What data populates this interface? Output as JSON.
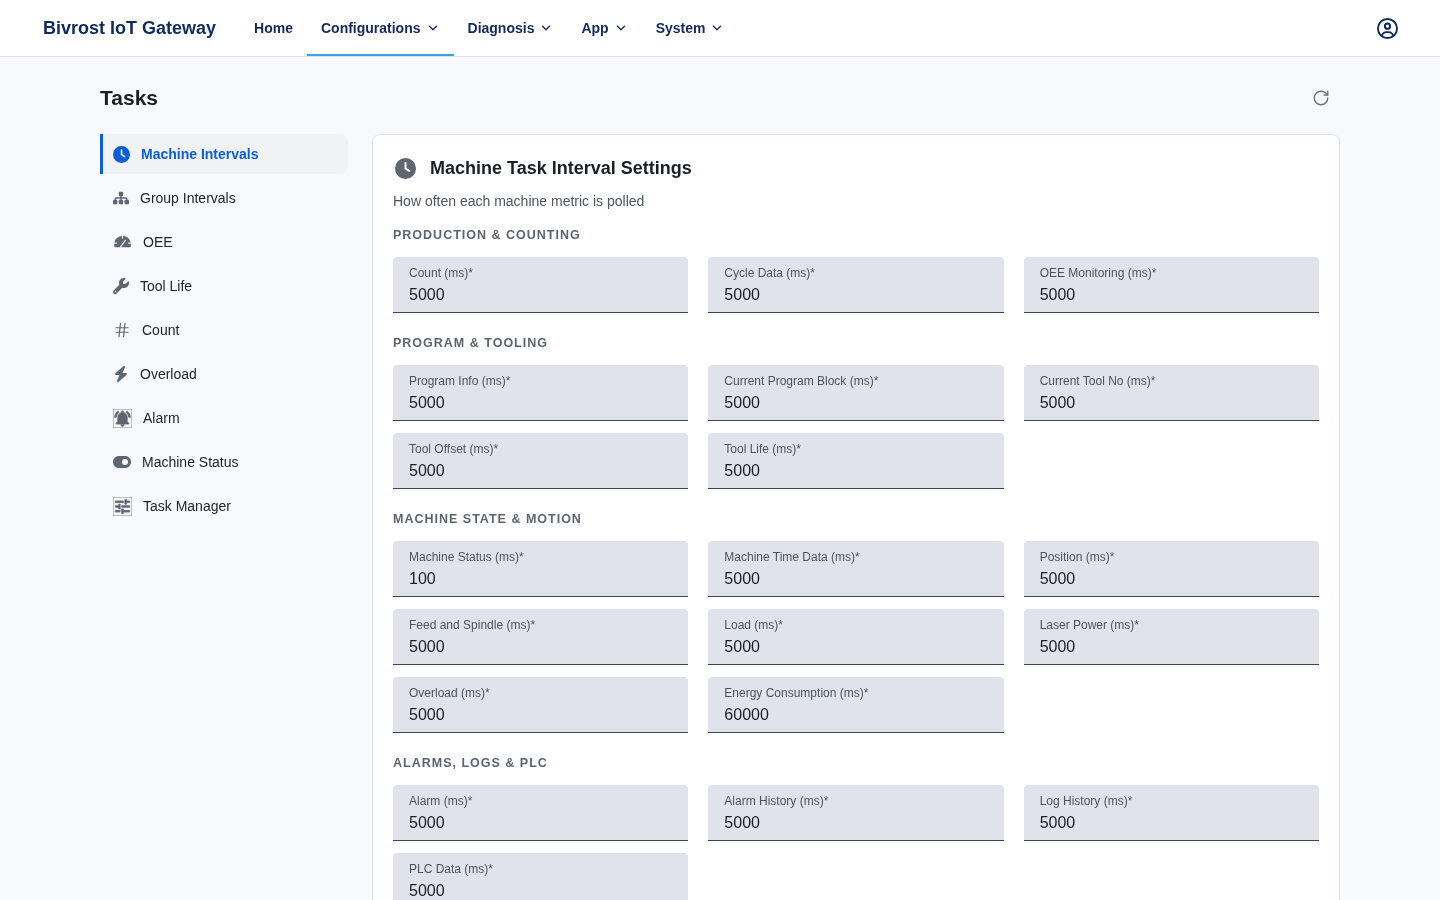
{
  "header": {
    "brand": "Bivrost IoT Gateway",
    "nav": [
      {
        "label": "Home",
        "selected": false,
        "has_menu": false
      },
      {
        "label": "Configurations",
        "selected": true,
        "has_menu": true
      },
      {
        "label": "Diagnosis",
        "selected": false,
        "has_menu": true
      },
      {
        "label": "App",
        "selected": false,
        "has_menu": true
      },
      {
        "label": "System",
        "selected": false,
        "has_menu": true
      }
    ]
  },
  "page": {
    "title": "Tasks"
  },
  "sidebar": {
    "items": [
      {
        "label": "Machine Intervals",
        "selected": true
      },
      {
        "label": "Group Intervals",
        "selected": false
      },
      {
        "label": "OEE",
        "selected": false
      },
      {
        "label": "Tool Life",
        "selected": false
      },
      {
        "label": "Count",
        "selected": false
      },
      {
        "label": "Overload",
        "selected": false
      },
      {
        "label": "Alarm",
        "selected": false
      },
      {
        "label": "Machine Status",
        "selected": false
      },
      {
        "label": "Task Manager",
        "selected": false
      }
    ]
  },
  "card": {
    "title": "Machine Task Interval Settings",
    "subtitle": "How often each machine metric is polled",
    "sections": [
      {
        "heading": "PRODUCTION & COUNTING",
        "fields": [
          {
            "label": "Count (ms)*",
            "value": "5000"
          },
          {
            "label": "Cycle Data (ms)*",
            "value": "5000"
          },
          {
            "label": "OEE Monitoring (ms)*",
            "value": "5000"
          }
        ]
      },
      {
        "heading": "PROGRAM & TOOLING",
        "fields": [
          {
            "label": "Program Info (ms)*",
            "value": "5000"
          },
          {
            "label": "Current Program Block (ms)*",
            "value": "5000"
          },
          {
            "label": "Current Tool No (ms)*",
            "value": "5000"
          },
          {
            "label": "Tool Offset (ms)*",
            "value": "5000"
          },
          {
            "label": "Tool Life (ms)*",
            "value": "5000"
          }
        ]
      },
      {
        "heading": "MACHINE STATE & MOTION",
        "fields": [
          {
            "label": "Machine Status (ms)*",
            "value": "100"
          },
          {
            "label": "Machine Time Data (ms)*",
            "value": "5000"
          },
          {
            "label": "Position (ms)*",
            "value": "5000"
          },
          {
            "label": "Feed and Spindle (ms)*",
            "value": "5000"
          },
          {
            "label": "Load (ms)*",
            "value": "5000"
          },
          {
            "label": "Laser Power (ms)*",
            "value": "5000"
          },
          {
            "label": "Overload (ms)*",
            "value": "5000"
          },
          {
            "label": "Energy Consumption (ms)*",
            "value": "60000"
          }
        ]
      },
      {
        "heading": "ALARMS, LOGS & PLC",
        "fields": [
          {
            "label": "Alarm (ms)*",
            "value": "5000"
          },
          {
            "label": "Alarm History (ms)*",
            "value": "5000"
          },
          {
            "label": "Log History (ms)*",
            "value": "5000"
          },
          {
            "label": "PLC Data (ms)*",
            "value": "5000"
          }
        ]
      }
    ]
  }
}
